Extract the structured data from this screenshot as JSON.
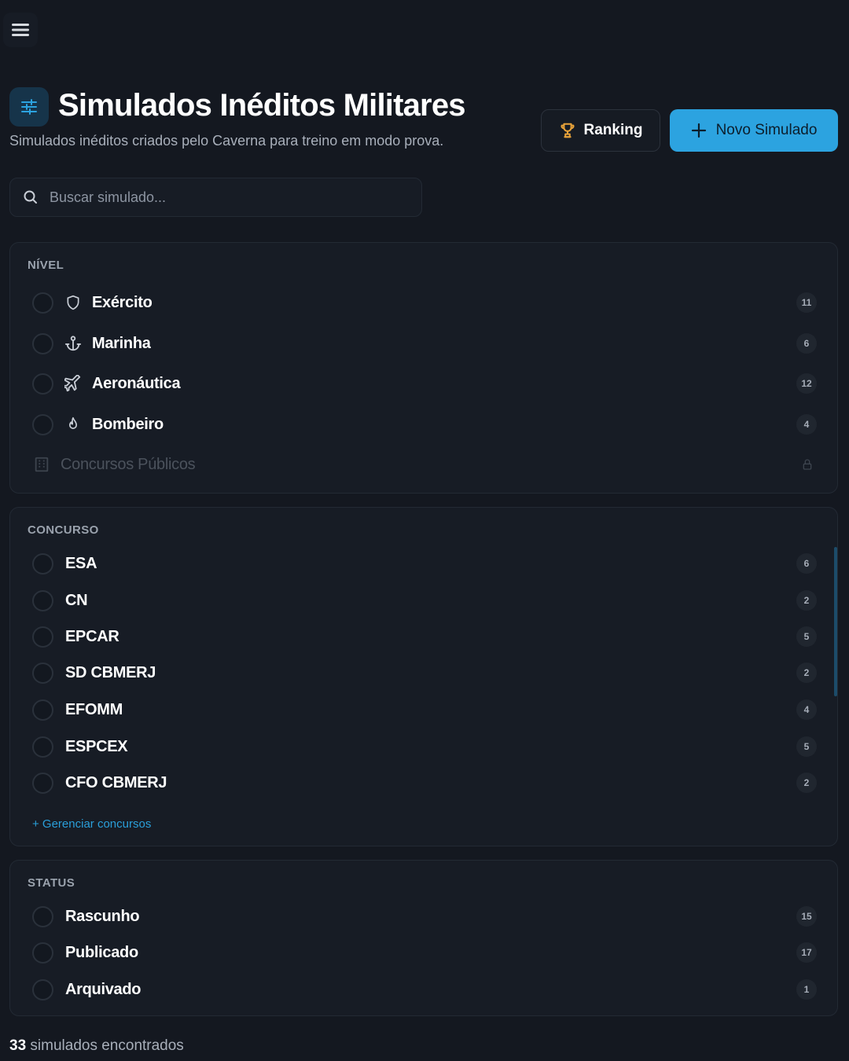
{
  "header": {
    "title": "Simulados Inéditos Militares",
    "subtitle": "Simulados inéditos criados pelo Caverna para treino em modo prova.",
    "ranking_label": "Ranking",
    "new_label": "Novo Simulado"
  },
  "search": {
    "placeholder": "Buscar simulado..."
  },
  "nivel": {
    "label": "NÍVEL",
    "items": [
      {
        "label": "Exército",
        "icon": "shield-icon",
        "count": "11"
      },
      {
        "label": "Marinha",
        "icon": "anchor-icon",
        "count": "6"
      },
      {
        "label": "Aeronáutica",
        "icon": "plane-icon",
        "count": "12"
      },
      {
        "label": "Bombeiro",
        "icon": "flame-icon",
        "count": "4"
      }
    ],
    "locked_item": {
      "label": "Concursos Públicos",
      "icon": "building-icon",
      "trailing_icon": "lock-icon"
    }
  },
  "concurso": {
    "label": "CONCURSO",
    "items": [
      {
        "label": "ESA",
        "count": "6"
      },
      {
        "label": "CN",
        "count": "2"
      },
      {
        "label": "EPCAR",
        "count": "5"
      },
      {
        "label": "SD CBMERJ",
        "count": "2"
      },
      {
        "label": "EFOMM",
        "count": "4"
      },
      {
        "label": "ESPCEX",
        "count": "5"
      },
      {
        "label": "CFO CBMERJ",
        "count": "2"
      }
    ],
    "manage_label": "+ Gerenciar concursos"
  },
  "status": {
    "label": "STATUS",
    "items": [
      {
        "label": "Rascunho",
        "count": "15"
      },
      {
        "label": "Publicado",
        "count": "17"
      },
      {
        "label": "Arquivado",
        "count": "1"
      }
    ]
  },
  "results": {
    "count": "33",
    "text": "simulados encontrados"
  },
  "colors": {
    "background": "#141820",
    "card": "#171c25",
    "accent": "#2ca3e0",
    "trophy": "#e8a33a"
  }
}
